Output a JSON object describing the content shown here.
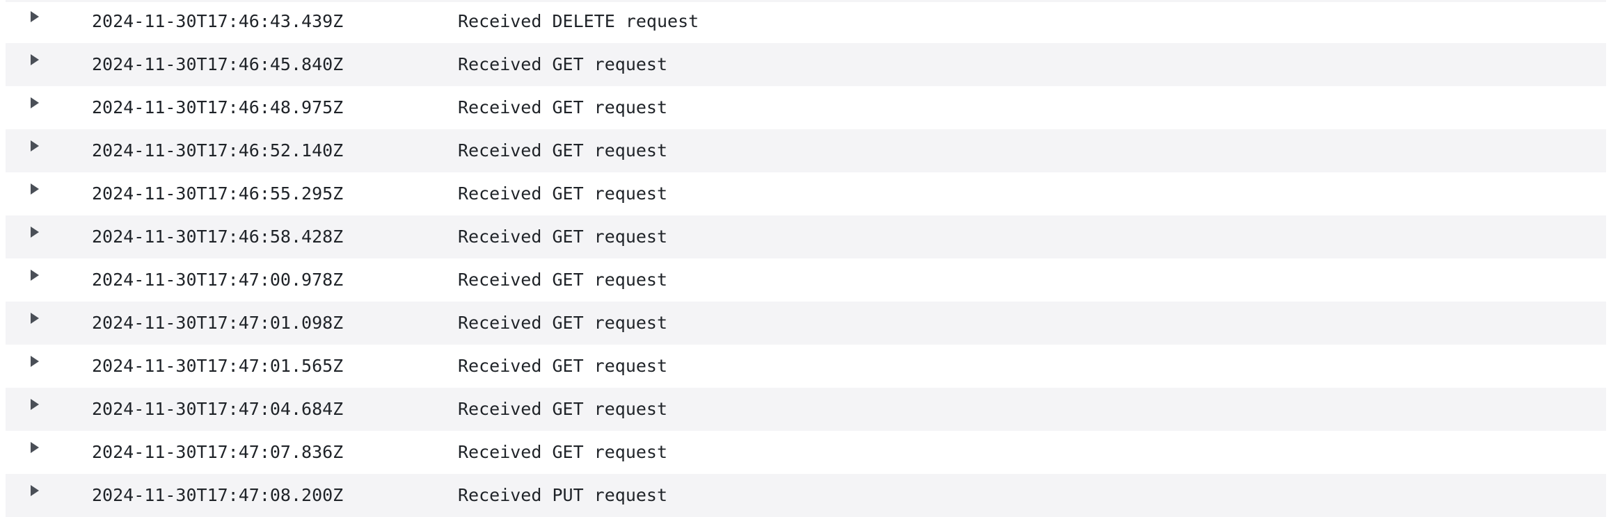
{
  "log": {
    "entries": [
      {
        "timestamp": "2024-11-30T17:46:43.439Z",
        "message": "Received DELETE request"
      },
      {
        "timestamp": "2024-11-30T17:46:45.840Z",
        "message": "Received GET request"
      },
      {
        "timestamp": "2024-11-30T17:46:48.975Z",
        "message": "Received GET request"
      },
      {
        "timestamp": "2024-11-30T17:46:52.140Z",
        "message": "Received GET request"
      },
      {
        "timestamp": "2024-11-30T17:46:55.295Z",
        "message": "Received GET request"
      },
      {
        "timestamp": "2024-11-30T17:46:58.428Z",
        "message": "Received GET request"
      },
      {
        "timestamp": "2024-11-30T17:47:00.978Z",
        "message": "Received GET request"
      },
      {
        "timestamp": "2024-11-30T17:47:01.098Z",
        "message": "Received GET request"
      },
      {
        "timestamp": "2024-11-30T17:47:01.565Z",
        "message": "Received GET request"
      },
      {
        "timestamp": "2024-11-30T17:47:04.684Z",
        "message": "Received GET request"
      },
      {
        "timestamp": "2024-11-30T17:47:07.836Z",
        "message": "Received GET request"
      },
      {
        "timestamp": "2024-11-30T17:47:08.200Z",
        "message": "Received PUT request"
      }
    ]
  },
  "icons": {
    "expand": "caret-right-icon"
  },
  "colors": {
    "row_alt_background": "#f4f4f6",
    "text": "#1f2328",
    "icon": "#4a4f57"
  }
}
